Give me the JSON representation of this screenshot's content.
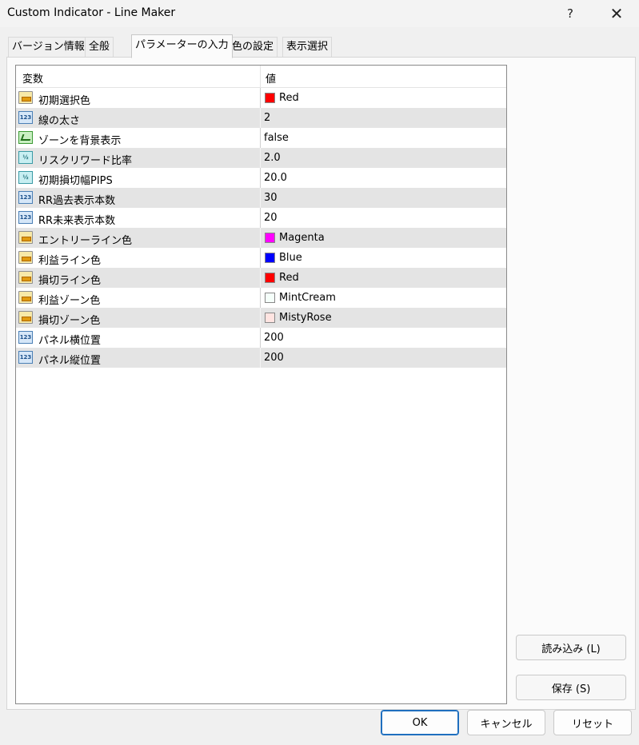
{
  "window": {
    "title": "Custom Indicator - Line Maker",
    "help": "?",
    "close": "✕"
  },
  "tabs": [
    {
      "label": "バージョン情報"
    },
    {
      "label": "全般"
    },
    {
      "label": "パラメーターの入力"
    },
    {
      "label": "色の設定"
    },
    {
      "label": "表示選択"
    }
  ],
  "grid": {
    "header": {
      "name": "変数",
      "value": "値"
    },
    "rows": [
      {
        "icon": "color-param-icon",
        "name": "初期選択色",
        "value": "Red",
        "swatch": "#ff0000"
      },
      {
        "icon": "int-param-icon",
        "name": "線の太さ",
        "value": "2"
      },
      {
        "icon": "bool-param-icon",
        "name": "ゾーンを背景表示",
        "value": "false"
      },
      {
        "icon": "double-param-icon",
        "name": "リスクリワード比率",
        "value": "2.0"
      },
      {
        "icon": "double-param-icon",
        "name": "初期損切幅PIPS",
        "value": "20.0"
      },
      {
        "icon": "int-param-icon",
        "name": "RR過去表示本数",
        "value": "30"
      },
      {
        "icon": "int-param-icon",
        "name": "RR未来表示本数",
        "value": "20"
      },
      {
        "icon": "color-param-icon",
        "name": "エントリーライン色",
        "value": "Magenta",
        "swatch": "#ff00ff"
      },
      {
        "icon": "color-param-icon",
        "name": "利益ライン色",
        "value": "Blue",
        "swatch": "#0000ff"
      },
      {
        "icon": "color-param-icon",
        "name": "損切ライン色",
        "value": "Red",
        "swatch": "#ff0000"
      },
      {
        "icon": "color-param-icon",
        "name": "利益ゾーン色",
        "value": "MintCream",
        "swatch": "#f5fffa"
      },
      {
        "icon": "color-param-icon",
        "name": "損切ゾーン色",
        "value": "MistyRose",
        "swatch": "#ffe4e1"
      },
      {
        "icon": "int-param-icon",
        "name": "パネル横位置",
        "value": "200"
      },
      {
        "icon": "int-param-icon",
        "name": "パネル縦位置",
        "value": "200"
      }
    ]
  },
  "side_buttons": {
    "load": "読み込み (L)",
    "save": "保存 (S)"
  },
  "footer": {
    "ok": "OK",
    "cancel": "キャンセル",
    "reset": "リセット"
  },
  "icon_text": {
    "int": "123",
    "double": "½"
  }
}
